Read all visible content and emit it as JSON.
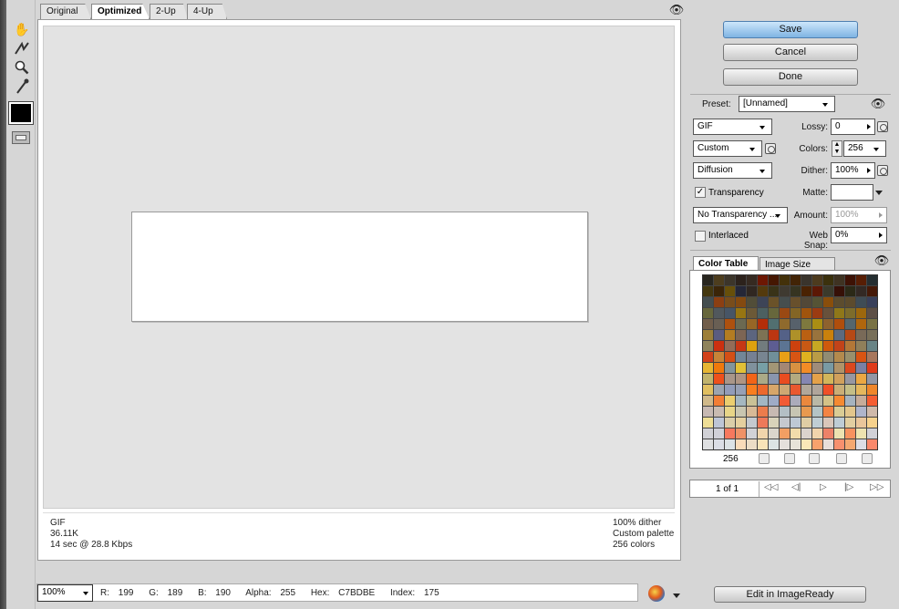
{
  "tabs": [
    "Original",
    "Optimized",
    "2-Up",
    "4-Up"
  ],
  "active_tab": "Optimized",
  "toolbar": {
    "tools": [
      "hand-tool",
      "slice-select-tool",
      "zoom-tool",
      "eyedropper-tool"
    ],
    "eyedropper_color": "#000000"
  },
  "info_left": [
    "GIF",
    "36.11K",
    "14 sec @ 28.8 Kbps"
  ],
  "info_right": [
    "100% dither",
    "Custom palette",
    "256 colors"
  ],
  "status": {
    "zoom": "100%",
    "r_label": "R:",
    "r": "199",
    "g_label": "G:",
    "g": "189",
    "b_label": "B:",
    "b": "190",
    "alpha_label": "Alpha:",
    "alpha": "255",
    "hex_label": "Hex:",
    "hex": "C7BDBE",
    "index_label": "Index:",
    "index": "175"
  },
  "buttons": {
    "save": "Save",
    "cancel": "Cancel",
    "done": "Done",
    "edit_imageready": "Edit in ImageReady"
  },
  "settings": {
    "preset_label": "Preset:",
    "preset": "[Unnamed]",
    "format": "GIF",
    "lossy_label": "Lossy:",
    "lossy": "0",
    "palette": "Custom",
    "colors_label": "Colors:",
    "colors": "256",
    "dither_algo": "Diffusion",
    "dither_label": "Dither:",
    "dither": "100%",
    "transparency_label": "Transparency",
    "transparency_checked": true,
    "matte_label": "Matte:",
    "matte": "",
    "trans_dither": "No Transparency ...",
    "amount_label": "Amount:",
    "amount": "100%",
    "interlaced_label": "Interlaced",
    "interlaced_checked": false,
    "websnap_label": "Web Snap:",
    "websnap": "0%"
  },
  "color_table": {
    "tabs": [
      "Color Table",
      "Image Size"
    ],
    "active": "Color Table",
    "count": "256"
  },
  "frames": {
    "label": "1 of 1"
  }
}
